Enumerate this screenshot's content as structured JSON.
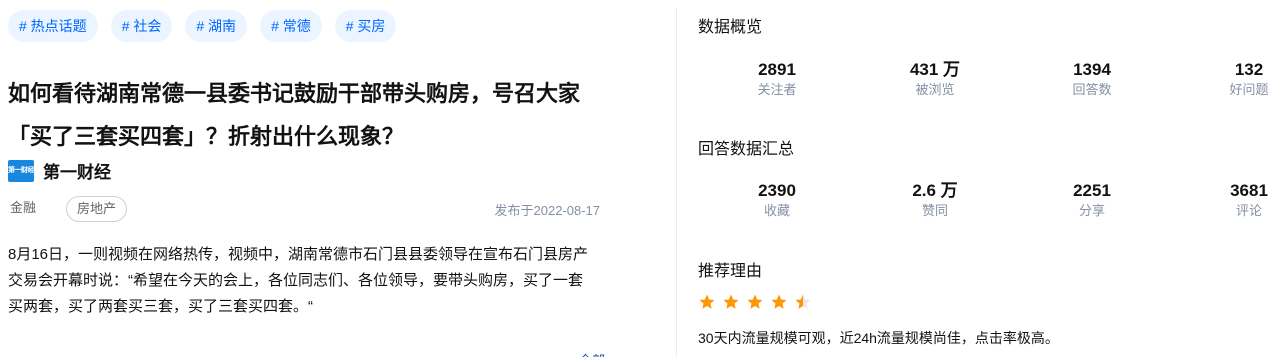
{
  "tags": [
    "# 热点话题",
    "# 社会",
    "# 湖南",
    "# 常德",
    "# 买房"
  ],
  "article": {
    "title_line1": "如何看待湖南常德一县委书记鼓励干部带头购房，号召大家",
    "title_line2": "「买了三套买四套」？折射出什么现象？",
    "source_logo_text": "第一财经",
    "source": "第一财经",
    "categories": [
      "金融",
      "房地产"
    ],
    "date": "发布于2022-08-17",
    "body_line1": "8月16日，一则视频在网络热传，视频中，湖南常德市石门县县委领导在宣布石门县房产",
    "body_line2": "交易会开幕时说：“希望在今天的会上，各位同志们、各位领导，要带头购房，买了一套",
    "body_line3": "买两套，买了两套买三套，买了三套买四套。“",
    "read_more": "全部"
  },
  "overview": {
    "title": "数据概览",
    "stats": [
      {
        "value": "2891",
        "label": "关注者"
      },
      {
        "value": "431 万",
        "label": "被浏览"
      },
      {
        "value": "1394",
        "label": "回答数"
      },
      {
        "value": "132",
        "label": "好问题"
      }
    ]
  },
  "answers": {
    "title": "回答数据汇总",
    "stats": [
      {
        "value": "2390",
        "label": "收藏"
      },
      {
        "value": "2.6 万",
        "label": "赞同"
      },
      {
        "value": "2251",
        "label": "分享"
      },
      {
        "value": "3681",
        "label": "评论"
      }
    ]
  },
  "recommend": {
    "title": "推荐理由",
    "rating": 4.5,
    "rating_max": 5,
    "star_color": "#ff9607",
    "star_empty_color": "#e8e8e8",
    "reason": "30天内流量规模可观，近24h流量规模尚佳，点击率极高。"
  }
}
